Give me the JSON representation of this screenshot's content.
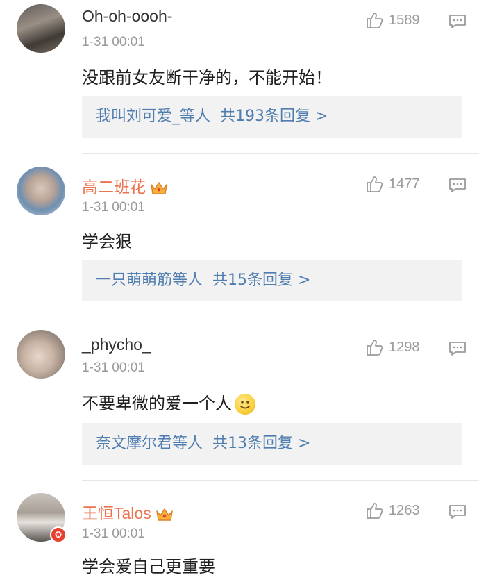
{
  "comments": [
    {
      "username": "Oh-oh-oooh-",
      "vip": false,
      "time": "1-31 00:01",
      "text": "没跟前女友断干净的，不能开始！",
      "likes": "1589",
      "reply": {
        "names": "我叫刘可爱_等人",
        "total": "共193条回复 >"
      }
    },
    {
      "username": "高二班花",
      "vip": true,
      "time": "1-31 00:01",
      "text": "学会狠",
      "likes": "1477",
      "reply": {
        "names": "一只萌萌筋等人",
        "total": "共15条回复 >"
      }
    },
    {
      "username": "_phycho_",
      "vip": false,
      "time": "1-31 00:01",
      "text": "不要卑微的爱一个人",
      "likes": "1298",
      "reply": {
        "names": "奈文摩尔君等人",
        "total": "共13条回复 >"
      }
    },
    {
      "username": "王恒Talos",
      "vip": true,
      "time": "1-31 00:01",
      "text": "学会爱自己更重要",
      "likes": "1263"
    }
  ],
  "icons": {
    "like": "thumbs-up-icon",
    "reply": "comment-icon",
    "vip": "crown-icon",
    "emoji": "smiley-emoji-icon"
  },
  "colors": {
    "vip_name": "#eb7350",
    "reply_link": "#507daf",
    "meta": "#9a9a9a"
  }
}
